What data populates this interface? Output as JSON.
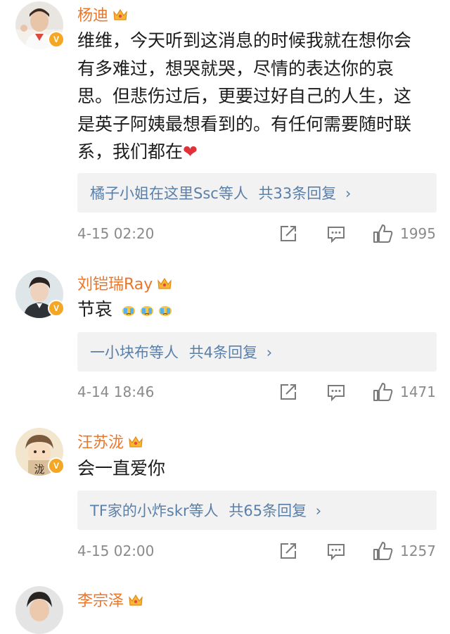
{
  "comments": [
    {
      "username": "杨迪",
      "text_lines": [
        "维维，今天听到这消息的时候我就在想你会",
        "有多难过，想哭就哭，尽情的表达你的哀",
        "思。但悲伤过后，更要过好自己的人生，这",
        "是英子阿姨最想看到的。有任何需要随时联",
        "系，我们都在"
      ],
      "heart_emoji": "❤",
      "reply_summary": "橘子小姐在这里Ssc等人",
      "reply_count": "共33条回复",
      "reply_chevron": "›",
      "time": "4-15 02:20",
      "likes": "1995"
    },
    {
      "username": "刘铠瑞Ray",
      "text": "节哀",
      "reply_summary": "一小块布等人",
      "reply_count": "共4条回复",
      "reply_chevron": "›",
      "time": "4-14 18:46",
      "likes": "1471"
    },
    {
      "username": "汪苏泷",
      "text": "会一直爱你",
      "avatar_text": "泷",
      "reply_summary": "TF家的小炸skr等人",
      "reply_count": "共65条回复",
      "reply_chevron": "›",
      "time": "4-15 02:00",
      "likes": "1257"
    },
    {
      "username": "李宗泽"
    }
  ],
  "badge_letter": "V",
  "colors": {
    "username": "#e8772e",
    "reply_link": "#5a7fa8",
    "meta": "#8a8a8a",
    "badge": "#f5a623",
    "heart": "#e0323a"
  }
}
